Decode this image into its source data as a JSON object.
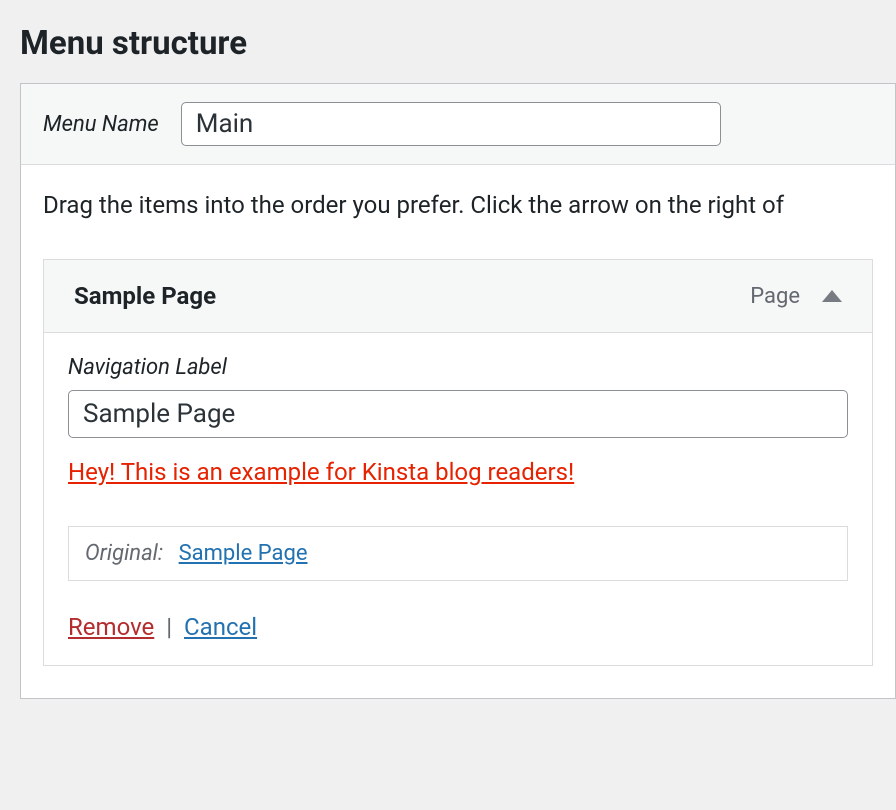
{
  "heading": "Menu structure",
  "menu_name_label": "Menu Name",
  "menu_name_value": "Main",
  "drag_hint": "Drag the items into the order you prefer. Click the arrow on the right of",
  "item": {
    "title": "Sample Page",
    "type_label": "Page",
    "nav_label_text": "Navigation Label",
    "nav_label_value": "Sample Page",
    "description_text": "Hey! This is an example for Kinsta blog readers!",
    "original_label": "Original:",
    "original_link_text": "Sample Page",
    "remove_text": "Remove",
    "separator": "|",
    "cancel_text": "Cancel"
  }
}
